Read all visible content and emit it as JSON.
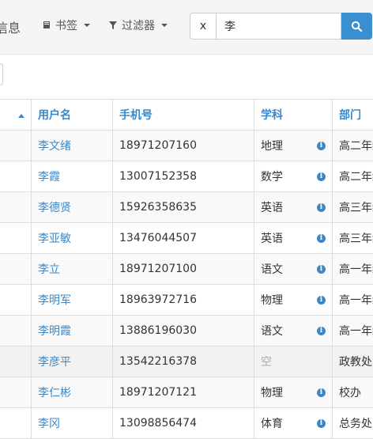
{
  "toolbar": {
    "title_fragment": "信息",
    "bookmark_label": "书签",
    "filter_label": "过滤器",
    "search_clear": "x",
    "search_value": "李",
    "icons": {
      "bookmark": "book-icon",
      "filter": "funnel-icon",
      "search": "search-icon"
    },
    "accent": "#3a8fd0"
  },
  "table": {
    "columns": [
      "",
      "用户名",
      "手机号",
      "学科",
      "部门"
    ],
    "rows": [
      {
        "name": "李文绪",
        "phone": "18971207160",
        "subject": "地理",
        "dept": "高二年级"
      },
      {
        "name": "李霞",
        "phone": "13007152358",
        "subject": "数学",
        "dept": "高二年级"
      },
      {
        "name": "李德贤",
        "phone": "15926358635",
        "subject": "英语",
        "dept": "高三年级"
      },
      {
        "name": "李亚敏",
        "phone": "13476044507",
        "subject": "英语",
        "dept": "高三年级"
      },
      {
        "name": "李立",
        "phone": "18971207100",
        "subject": "语文",
        "dept": "高一年级"
      },
      {
        "name": "李明军",
        "phone": "18963972716",
        "subject": "物理",
        "dept": "高一年级"
      },
      {
        "name": "李明霞",
        "phone": "13886196030",
        "subject": "语文",
        "dept": "高一年级"
      },
      {
        "name": "李彦平",
        "phone": "13542216378",
        "subject": "空",
        "dept": "政教处"
      },
      {
        "name": "李仁彬",
        "phone": "18971207121",
        "subject": "物理",
        "dept": "校办"
      },
      {
        "name": "李冈",
        "phone": "13098856474",
        "subject": "体育",
        "dept": "总务处"
      }
    ]
  }
}
